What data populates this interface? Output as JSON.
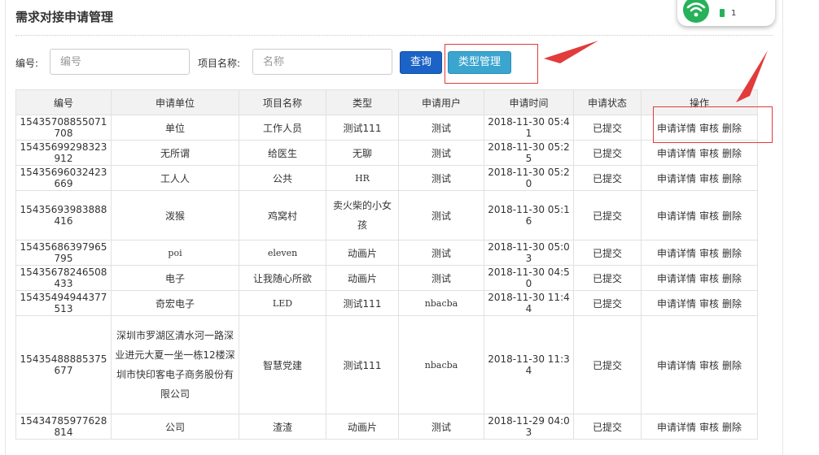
{
  "page": {
    "title": "需求对接申请管理"
  },
  "search": {
    "number_label": "编号:",
    "number_placeholder": "编号",
    "number_value": "",
    "project_label": "项目名称:",
    "project_placeholder": "名称",
    "project_value": "",
    "query_label": "查询",
    "type_manage_label": "类型管理"
  },
  "table": {
    "headers": [
      "编号",
      "申请单位",
      "项目名称",
      "类型",
      "申请用户",
      "申请时间",
      "申请状态",
      "操作"
    ],
    "actions": {
      "detail": "申请详情",
      "review": "审核",
      "delete": "删除"
    },
    "rows": [
      {
        "id": "15435708855071708",
        "unit": "单位",
        "project": "工作人员",
        "type": "测试111",
        "user": "测试",
        "time": "2018-11-30 05:41",
        "status": "已提交"
      },
      {
        "id": "15435699298323912",
        "unit": "无所谓",
        "project": "给医生",
        "type": "无聊",
        "user": "测试",
        "time": "2018-11-30 05:25",
        "status": "已提交"
      },
      {
        "id": "15435696032423669",
        "unit": "工人人",
        "project": "公共",
        "type": "HR",
        "user": "测试",
        "time": "2018-11-30 05:20",
        "status": "已提交"
      },
      {
        "id": "15435693983888416",
        "unit": "泼猴",
        "project": "鸡窝村",
        "type": "卖火柴的小女孩",
        "user": "测试",
        "time": "2018-11-30 05:16",
        "status": "已提交"
      },
      {
        "id": "15435686397965795",
        "unit": "poi",
        "project": "eleven",
        "type": "动画片",
        "user": "测试",
        "time": "2018-11-30 05:03",
        "status": "已提交"
      },
      {
        "id": "15435678246508433",
        "unit": "电子",
        "project": "让我随心所欲",
        "type": "动画片",
        "user": "测试",
        "time": "2018-11-30 04:50",
        "status": "已提交"
      },
      {
        "id": "15435494944377513",
        "unit": "奇宏电子",
        "project": "LED",
        "type": "测试111",
        "user": "nbacba",
        "time": "2018-11-30 11:44",
        "status": "已提交"
      },
      {
        "id": "15435488885375677",
        "unit": "深圳市罗湖区清水河一路深业进元大夏一坐一栋12楼深圳市快印客电子商务股份有限公司",
        "project": "智慧党建",
        "type": "测试111",
        "user": "nbacba",
        "time": "2018-11-30 11:34",
        "status": "已提交"
      },
      {
        "id": "15434785977628814",
        "unit": "公司",
        "project": "渣渣",
        "type": "动画片",
        "user": "测试",
        "time": "2018-11-29 04:03",
        "status": "已提交"
      }
    ]
  },
  "widget": {
    "count": "1"
  },
  "colors": {
    "query_button": "#1b63c6",
    "type_button": "#3aa5cf",
    "annotation": "#e23b3b",
    "wifi": "#27b15a"
  }
}
